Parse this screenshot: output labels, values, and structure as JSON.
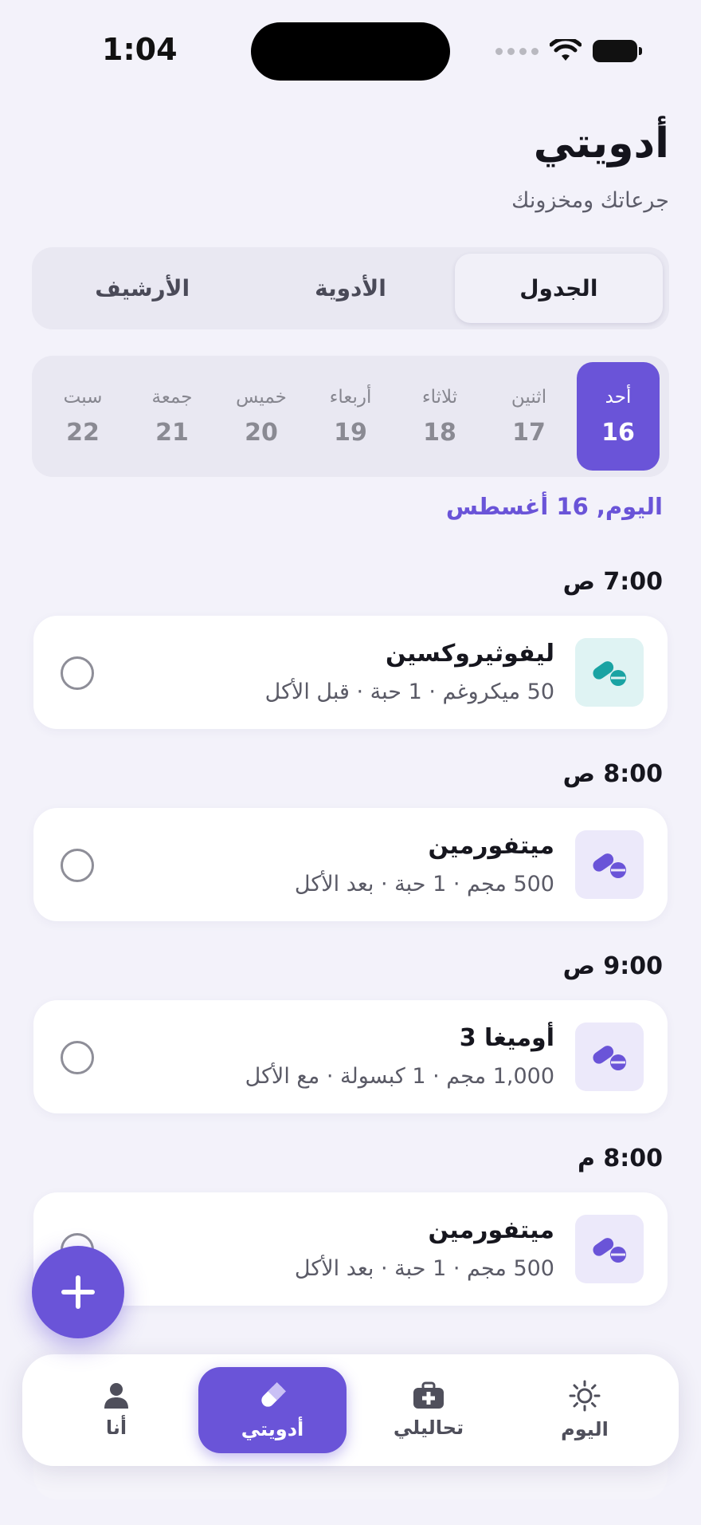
{
  "status_bar": {
    "time": "1:04"
  },
  "header": {
    "title": "أدويتي",
    "subtitle": "جرعاتك ومخزونك"
  },
  "segments": [
    {
      "label": "الجدول",
      "active": true
    },
    {
      "label": "الأدوية",
      "active": false
    },
    {
      "label": "الأرشيف",
      "active": false
    }
  ],
  "days": [
    {
      "name": "أحد",
      "num": "16",
      "active": true
    },
    {
      "name": "اثنين",
      "num": "17"
    },
    {
      "name": "ثلاثاء",
      "num": "18"
    },
    {
      "name": "أربعاء",
      "num": "19"
    },
    {
      "name": "خميس",
      "num": "20"
    },
    {
      "name": "جمعة",
      "num": "21"
    },
    {
      "name": "سبت",
      "num": "22"
    }
  ],
  "today_label": "اليوم, 16 أغسطس",
  "doses": [
    {
      "time": "7:00 ص",
      "name": "ليفوثيروكسين",
      "details": "50 ميكروغم · 1 حبة · قبل الأكل",
      "icon": "pills-icon",
      "color": "#1aa3a3"
    },
    {
      "time": "8:00 ص",
      "name": "ميتفورمين",
      "details": "500 مجم · 1 حبة · بعد الأكل",
      "icon": "pills-icon",
      "color": "#6a54d8"
    },
    {
      "time": "9:00 ص",
      "name": "أوميغا 3",
      "details": "1,000 مجم · 1 كبسولة · مع الأكل",
      "icon": "pills-icon",
      "color": "#6a54d8"
    },
    {
      "time": "8:00 م",
      "name": "ميتفورمين",
      "details": "500 مجم · 1 حبة · بعد الأكل",
      "icon": "pills-icon",
      "color": "#6a54d8"
    }
  ],
  "nav": [
    {
      "label": "اليوم",
      "icon": "sun-icon"
    },
    {
      "label": "تحاليلي",
      "icon": "medical-kit-icon"
    },
    {
      "label": "أدويتي",
      "icon": "pill-icon",
      "active": true
    },
    {
      "label": "أنا",
      "icon": "person-icon"
    }
  ],
  "colors": {
    "accent": "#6a54d8",
    "teal": "#1aa3a3",
    "background": "#f3f2fa"
  }
}
